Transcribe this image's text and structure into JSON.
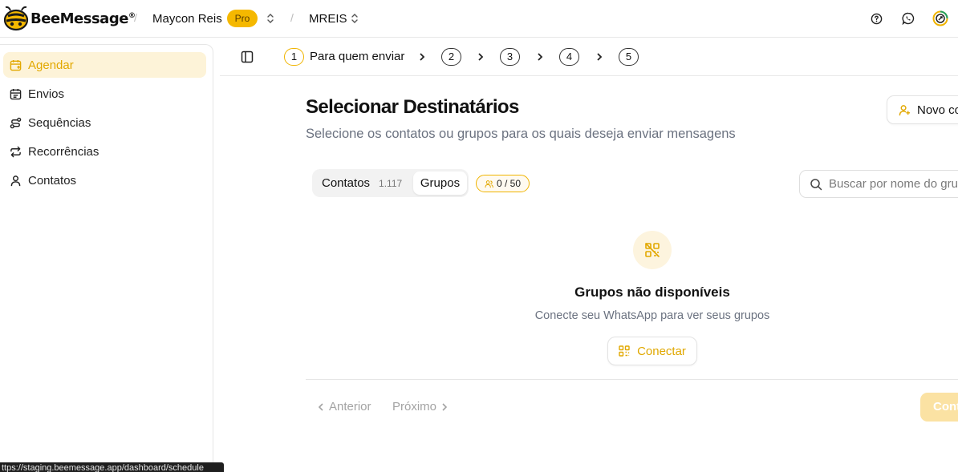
{
  "header": {
    "logo_text": "BeeMessage",
    "logo_mark": "®",
    "separator": "/",
    "user_name": "Maycon Reis",
    "plan_badge": "Pro",
    "workspace": "MREIS",
    "icons": [
      "help-icon",
      "whatsapp-icon",
      "avatar-ring-icon"
    ]
  },
  "sidebar": {
    "items": [
      {
        "label": "Agendar",
        "icon": "calendar-plus-icon",
        "active": true
      },
      {
        "label": "Envios",
        "icon": "calendar-icon",
        "active": false
      },
      {
        "label": "Sequências",
        "icon": "route-icon",
        "active": false
      },
      {
        "label": "Recorrências",
        "icon": "repeat-icon",
        "active": false
      },
      {
        "label": "Contatos",
        "icon": "user-icon",
        "active": false
      }
    ]
  },
  "stepper": {
    "steps": [
      {
        "number": "1",
        "label": "Para quem enviar",
        "current": true
      },
      {
        "number": "2"
      },
      {
        "number": "3"
      },
      {
        "number": "4"
      },
      {
        "number": "5"
      }
    ]
  },
  "main": {
    "title": "Selecionar Destinatários",
    "subtitle": "Selecione os contatos ou grupos para os quais deseja enviar mensagens",
    "new_contact_button": "Novo co",
    "tabs": {
      "contatos_label": "Contatos",
      "contatos_count": "1.117",
      "grupos_label": "Grupos",
      "active": "Grupos"
    },
    "limit_badge": "0 / 50",
    "search": {
      "placeholder": "Buscar por nome do grupo",
      "value": ""
    },
    "empty_state": {
      "icon": "qr-code-off-icon",
      "title": "Grupos não disponíveis",
      "text": "Conecte seu WhatsApp para ver seus grupos",
      "button": "Conectar"
    },
    "pager": {
      "previous": "Anterior",
      "next": "Próximo",
      "continue": "Cont"
    }
  },
  "status_bar": {
    "url": "ttps://staging.beemessage.app/dashboard/schedule"
  },
  "colors": {
    "accent": "#f0b400",
    "accent_text": "#e2a800",
    "active_bg": "#fdf3d8",
    "muted_text": "#6b7280"
  }
}
